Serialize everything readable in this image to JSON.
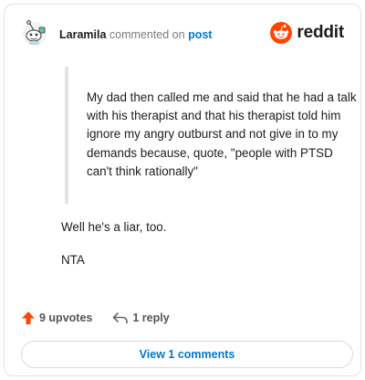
{
  "header": {
    "username": "Laramila",
    "action_text": "commented on",
    "post_link": "post",
    "brand": "reddit",
    "brand_color": "#ff4500",
    "avatar_icon": "snoo-avatar-icon"
  },
  "comment": {
    "quote": "My dad then called me and said that he had a talk with his therapist and that his therapist told him ignore my angry outburst and not give in to my demands because, quote, \"people with PTSD can't think rationally\"",
    "paragraphs": [
      "Well he's a liar, too.",
      "NTA"
    ]
  },
  "actions": {
    "upvotes": "9 upvotes",
    "replies": "1 reply",
    "upvote_icon": "upvote-arrow-icon",
    "reply_icon": "reply-arrow-icon",
    "upvote_color": "#ff4500"
  },
  "view_comments_label": "View 1 comments"
}
